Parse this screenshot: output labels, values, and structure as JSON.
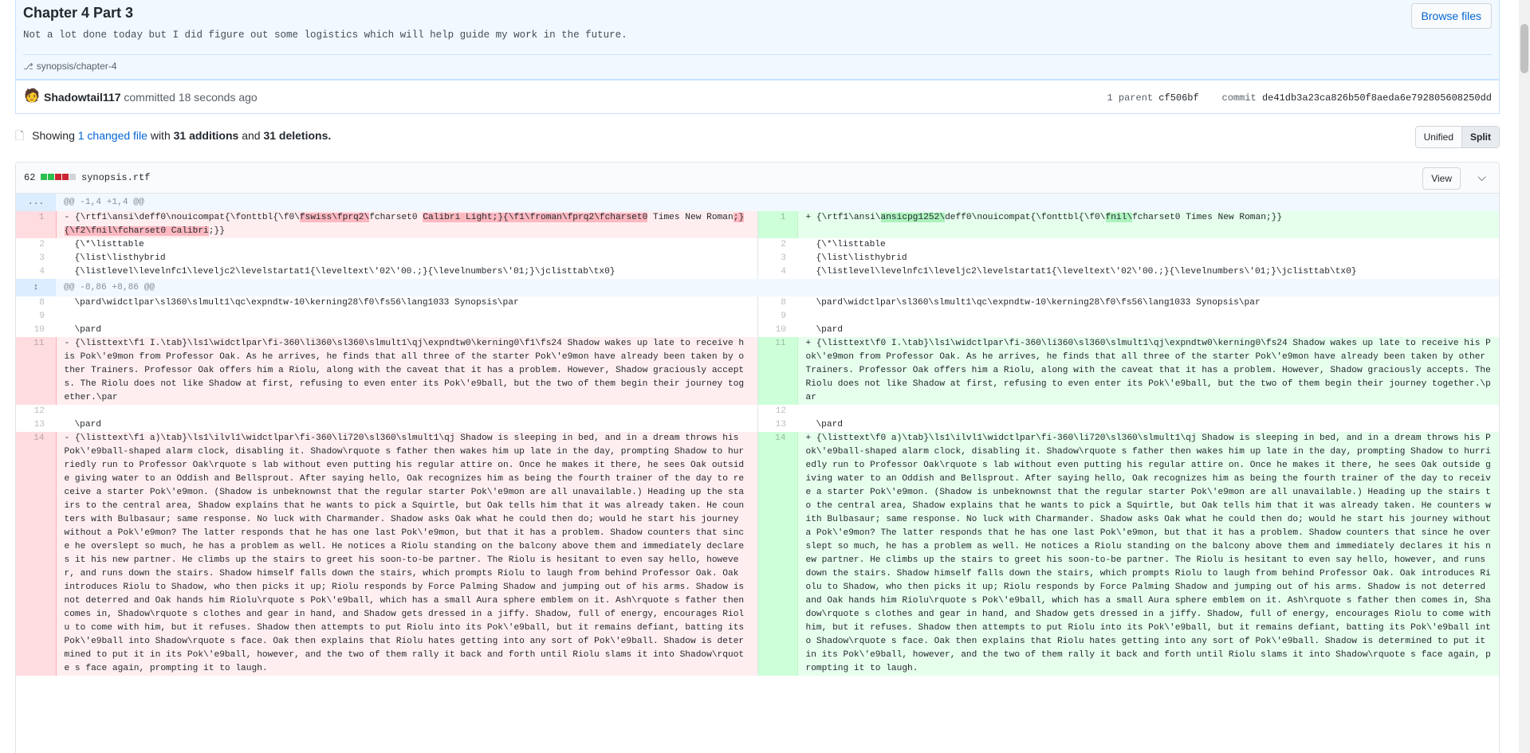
{
  "commit": {
    "title": "Chapter 4 Part 3",
    "description": "Not a lot done today but I did figure out some logistics which will help guide my work in the future.",
    "branch": "synopsis/chapter-4",
    "browse_label": "Browse files",
    "author": "Shadowtail117",
    "action": "committed 18 seconds ago",
    "parent_label": "1 parent",
    "parent_sha": "cf506bf",
    "commit_label": "commit",
    "commit_sha": "de41db3a23ca826b50f8aeda6e792805608250dd"
  },
  "toc": {
    "showing": "Showing",
    "changed_files": "1 changed file",
    "with": "with",
    "additions": "31 additions",
    "and": "and",
    "deletions": "31 deletions.",
    "unified_label": "Unified",
    "split_label": "Split"
  },
  "file": {
    "count": "62",
    "name": "synopsis.rtf",
    "view_label": "View",
    "diffstat_colors": [
      "#2cbe4e",
      "#2cbe4e",
      "#cb2431",
      "#cb2431",
      "#d1d5da"
    ]
  },
  "diff": {
    "hunk1": "@@ -1,4 +1,4 @@",
    "hunk2": "@@ -8,86 +8,86 @@",
    "hunk1_marker": "...",
    "lines": {
      "l1_left_1": "- {\\rtf1\\ansi\\deff0\\nouicompat{\\fonttbl{\\f0\\",
      "l1_left_2": "fswiss\\fprq2\\",
      "l1_left_3": "fcharset0 ",
      "l1_left_4": "Calibri Light;}{\\f1\\froman\\fprq2\\fcharset0",
      "l1_left_5": " Times New Roman",
      "l1_left_6": ";}",
      "l1_left_7": "{\\f2\\fnil\\fcharset0 Calibri",
      "l1_left_8": ";}}",
      "l1_right_1": "+ {\\rtf1\\ansi\\",
      "l1_right_2": "ansicpg1252\\",
      "l1_right_3": "deff0\\nouicompat{\\fonttbl{\\f0\\",
      "l1_right_4": "fnil\\",
      "l1_right_5": "fcharset0 Times New Roman;}}",
      "l2": "  {\\*\\listtable",
      "l3": "  {\\list\\listhybrid",
      "l4": "  {\\listlevel\\levelnfc1\\leveljc2\\levelstartat1{\\leveltext\\'02\\'00.;}{\\levelnumbers\\'01;}\\jclisttab\\tx0}",
      "l8": "  \\pard\\widctlpar\\sl360\\slmult1\\qc\\expndtw-10\\kerning28\\f0\\fs56\\lang1033 Synopsis\\par",
      "l9": "",
      "l10": "  \\pard",
      "l11_left": "- {\\listtext\\f1 I.\\tab}\\ls1\\widctlpar\\fi-360\\li360\\sl360\\slmult1\\qj\\expndtw0\\kerning0\\f1\\fs24 Shadow wakes up late to receive his Pok\\'e9mon from Professor Oak. As he arrives, he finds that all three of the starter Pok\\'e9mon have already been taken by other Trainers. Professor Oak offers him a Riolu, along with the caveat that it has a problem. However, Shadow graciously accepts. The Riolu does not like Shadow at first, refusing to even enter its Pok\\'e9ball, but the two of them begin their journey together.\\par",
      "l11_right": "+ {\\listtext\\f0 I.\\tab}\\ls1\\widctlpar\\fi-360\\li360\\sl360\\slmult1\\qj\\expndtw0\\kerning0\\fs24 Shadow wakes up late to receive his Pok\\'e9mon from Professor Oak. As he arrives, he finds that all three of the starter Pok\\'e9mon have already been taken by other Trainers. Professor Oak offers him a Riolu, along with the caveat that it has a problem. However, Shadow graciously accepts. The Riolu does not like Shadow at first, refusing to even enter its Pok\\'e9ball, but the two of them begin their journey together.\\par",
      "l12": "",
      "l13": "  \\pard",
      "l14_left": "- {\\listtext\\f1 a)\\tab}\\ls1\\ilvl1\\widctlpar\\fi-360\\li720\\sl360\\slmult1\\qj Shadow is sleeping in bed, and in a dream throws his Pok\\'e9ball-shaped alarm clock, disabling it. Shadow\\rquote s father then wakes him up late in the day, prompting Shadow to hurriedly run to Professor Oak\\rquote s lab without even putting his regular attire on. Once he makes it there, he sees Oak outside giving water to an Oddish and Bellsprout. After saying hello, Oak recognizes him as being the fourth trainer of the day to receive a starter Pok\\'e9mon. (Shadow is unbeknownst that the regular starter Pok\\'e9mon are all unavailable.) Heading up the stairs to the central area, Shadow explains that he wants to pick a Squirtle, but Oak tells him that it was already taken. He counters with Bulbasaur; same response. No luck with Charmander. Shadow asks Oak what he could then do; would he start his journey without a Pok\\'e9mon? The latter responds that he has one last Pok\\'e9mon, but that it has a problem. Shadow counters that since he overslept so much, he has a problem as well. He notices a Riolu standing on the balcony above them and immediately declares it his new partner. He climbs up the stairs to greet his soon-to-be partner. The Riolu is hesitant to even say hello, however, and runs down the stairs. Shadow himself falls down the stairs, which prompts Riolu to laugh from behind Professor Oak. Oak introduces Riolu to Shadow, who then picks it up; Riolu responds by Force Palming Shadow and jumping out of his arms. Shadow is not deterred and Oak hands him Riolu\\rquote s Pok\\'e9ball, which has a small Aura sphere emblem on it. Ash\\rquote s father then comes in, Shadow\\rquote s clothes and gear in hand, and Shadow gets dressed in a jiffy. Shadow, full of energy, encourages Riolu to come with him, but it refuses. Shadow then attempts to put Riolu into its Pok\\'e9ball, but it remains defiant, batting its Pok\\'e9ball into Shadow\\rquote s face. Oak then explains that Riolu hates getting into any sort of Pok\\'e9ball. Shadow is determined to put it in its Pok\\'e9ball, however, and the two of them rally it back and forth until Riolu slams it into Shadow\\rquote s face again, prompting it to laugh.",
      "l14_right": "+ {\\listtext\\f0 a)\\tab}\\ls1\\ilvl1\\widctlpar\\fi-360\\li720\\sl360\\slmult1\\qj Shadow is sleeping in bed, and in a dream throws his Pok\\'e9ball-shaped alarm clock, disabling it. Shadow\\rquote s father then wakes him up late in the day, prompting Shadow to hurriedly run to Professor Oak\\rquote s lab without even putting his regular attire on. Once he makes it there, he sees Oak outside giving water to an Oddish and Bellsprout. After saying hello, Oak recognizes him as being the fourth trainer of the day to receive a starter Pok\\'e9mon. (Shadow is unbeknownst that the regular starter Pok\\'e9mon are all unavailable.) Heading up the stairs to the central area, Shadow explains that he wants to pick a Squirtle, but Oak tells him that it was already taken. He counters with Bulbasaur; same response. No luck with Charmander. Shadow asks Oak what he could then do; would he start his journey without a Pok\\'e9mon? The latter responds that he has one last Pok\\'e9mon, but that it has a problem. Shadow counters that since he overslept so much, he has a problem as well. He notices a Riolu standing on the balcony above them and immediately declares it his new partner. He climbs up the stairs to greet his soon-to-be partner. The Riolu is hesitant to even say hello, however, and runs down the stairs. Shadow himself falls down the stairs, which prompts Riolu to laugh from behind Professor Oak. Oak introduces Riolu to Shadow, who then picks it up; Riolu responds by Force Palming Shadow and jumping out of his arms. Shadow is not deterred and Oak hands him Riolu\\rquote s Pok\\'e9ball, which has a small Aura sphere emblem on it. Ash\\rquote s father then comes in, Shadow\\rquote s clothes and gear in hand, and Shadow gets dressed in a jiffy. Shadow, full of energy, encourages Riolu to come with him, but it refuses. Shadow then attempts to put Riolu into its Pok\\'e9ball, but it remains defiant, batting its Pok\\'e9ball into Shadow\\rquote s face. Oak then explains that Riolu hates getting into any sort of Pok\\'e9ball. Shadow is determined to put it in its Pok\\'e9ball, however, and the two of them rally it back and forth until Riolu slams it into Shadow\\rquote s face again, prompting it to laugh."
    },
    "numbers": {
      "n1": "1",
      "n2": "2",
      "n3": "3",
      "n4": "4",
      "n8": "8",
      "n9": "9",
      "n10": "10",
      "n11": "11",
      "n12": "12",
      "n13": "13",
      "n14": "14"
    }
  }
}
